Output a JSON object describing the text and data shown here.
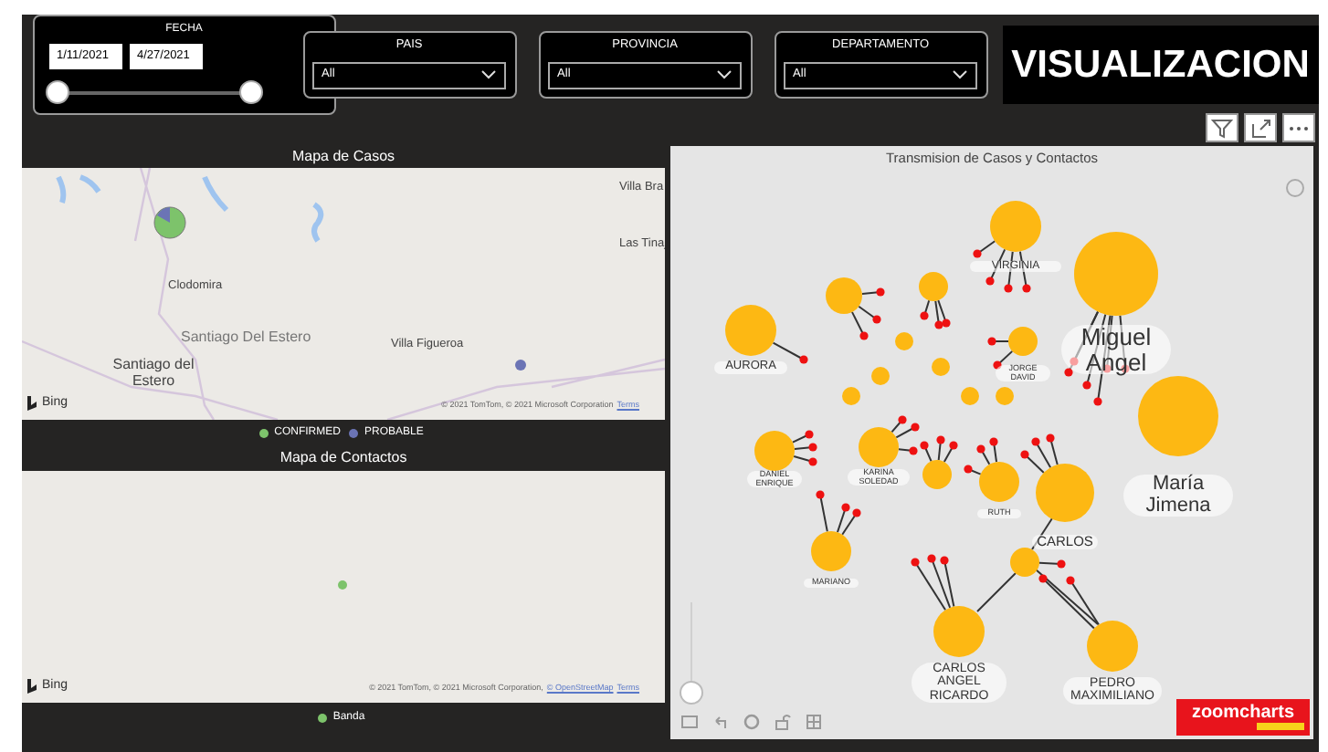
{
  "filters": {
    "date": {
      "label": "FECHA",
      "start": "1/11/2021",
      "end": "4/27/2021",
      "thumbs": [
        {
          "level": 0
        },
        {
          "level": 1
        }
      ]
    },
    "dropdowns": [
      {
        "label": "PAIS",
        "value": "All"
      },
      {
        "label": "PROVINCIA",
        "value": "All"
      },
      {
        "label": "DEPARTAMENTO",
        "value": "All"
      }
    ]
  },
  "title": "VISUALIZACION",
  "case_map": {
    "title": "Mapa de Casos",
    "places": [
      "Villa Bra",
      "Las Tinaj",
      "Clodomira",
      "Santiago Del Estero",
      "Villa Figueroa",
      "Santiago del Estero"
    ],
    "provider": "Bing",
    "copyright": "© 2021 TomTom, © 2021 Microsoft Corporation",
    "terms": "Terms",
    "legend": [
      {
        "label": "CONFIRMED",
        "color": "#7dc36b"
      },
      {
        "label": "PROBABLE",
        "color": "#6b74b5"
      }
    ]
  },
  "contact_map": {
    "title": "Mapa de Contactos",
    "provider": "Bing",
    "copyright": "© 2021 TomTom, © 2021 Microsoft Corporation,",
    "osm": "© OpenStreetMap",
    "terms": "Terms",
    "legend": [
      {
        "label": "Banda",
        "color": "#7dc36b"
      }
    ]
  },
  "network": {
    "title": "Transmision de Casos y Contactos",
    "nodes": [
      {
        "label": "VIRGINIA"
      },
      {
        "label": "Miguel Angel"
      },
      {
        "label": "María Jimena"
      },
      {
        "label": "AURORA"
      },
      {
        "label": "JORGE DAVID"
      },
      {
        "label": "DANIEL ENRIQUE"
      },
      {
        "label": "KARINA SOLEDAD"
      },
      {
        "label": "RUTH"
      },
      {
        "label": "CARLOS"
      },
      {
        "label": "MARIANO"
      },
      {
        "label": "CARLOS ANGEL RICARDO"
      },
      {
        "label": "PEDRO MAXIMILIANO"
      }
    ],
    "logo": "zoomcharts"
  }
}
